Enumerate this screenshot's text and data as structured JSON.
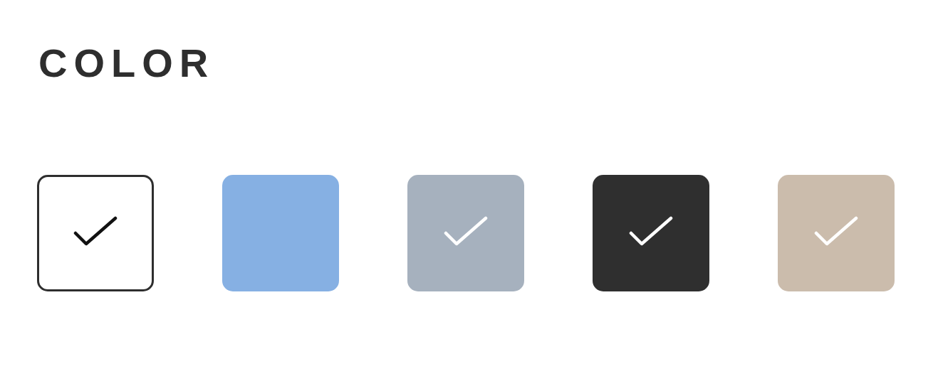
{
  "heading": "COLOR",
  "swatches": [
    {
      "color": "#ffffff",
      "checked": true
    },
    {
      "color": "#86b0e3",
      "checked": false
    },
    {
      "color": "#a6b1be",
      "checked": true
    },
    {
      "color": "#2f2f2f",
      "checked": true
    },
    {
      "color": "#cbbcac",
      "checked": true
    }
  ]
}
